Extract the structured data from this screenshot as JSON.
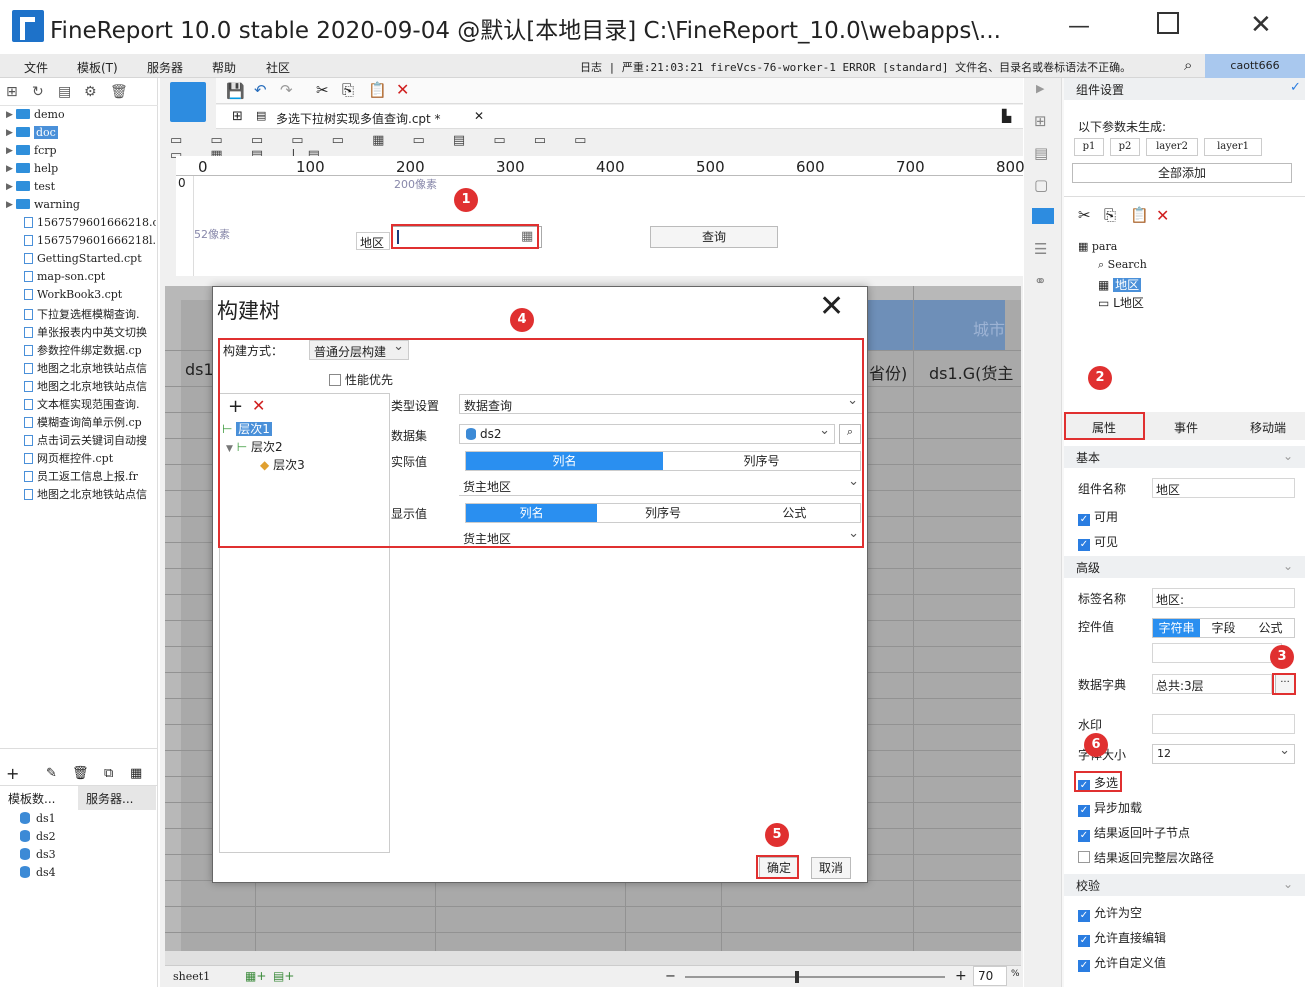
{
  "window": {
    "title": "FineReport 10.0 stable 2020-09-04 @默认[本地目录]    C:\\FineReport_10.0\\webapps\\..."
  },
  "menu": {
    "items": [
      "文件",
      "模板(T)",
      "服务器",
      "帮助",
      "社区"
    ],
    "log": "日志 | 严重:21:03:21 fireVcs-76-worker-1 ERROR [standard] 文件名、目录名或卷标语法不正确。",
    "user": "caott666"
  },
  "left": {
    "folders": [
      "demo",
      "doc",
      "fcrp",
      "help",
      "test",
      "warning"
    ],
    "files": [
      "1567579601666218.cp",
      "1567579601666218l.c",
      "GettingStarted.cpt",
      "map-son.cpt",
      "WorkBook3.cpt",
      "下拉复选框模糊查询.",
      "单张报表内中英文切换",
      "参数控件绑定数据.cp",
      "地图之北京地铁站点信",
      "地图之北京地铁站点信",
      "文本框实现范围查询.",
      "模糊查询简单示例.cp",
      "点击词云关键词自动搜",
      "网页框控件.cpt",
      "员工返工信息上报.fr",
      "地图之北京地铁站点信"
    ],
    "tabs": [
      "模板数...",
      "服务器..."
    ],
    "datasets": [
      "ds1",
      "ds2",
      "ds3",
      "ds4"
    ]
  },
  "editor": {
    "tab": "多选下拉树实现多值查询.cpt *",
    "ruler": [
      "0",
      "100",
      "200",
      "300",
      "400",
      "500",
      "600",
      "700",
      "800"
    ],
    "hint1": "200像素",
    "hint2": "52像素",
    "label": "地区",
    "query_button": "查询",
    "cell_ds1": "ds1",
    "cell_prov": "省份)",
    "cell_ds1g": "ds1.G(货主",
    "cell_city": "城市",
    "sheet": "sheet1",
    "zoom": "70",
    "zoom_unit": "%"
  },
  "dialog": {
    "title": "构建树",
    "method_label": "构建方式：",
    "method_value": "普通分层构建",
    "perf_label": "性能优先",
    "levels": [
      "层次1",
      "层次2",
      "层次3"
    ],
    "type_label": "类型设置",
    "type_value": "数据查询",
    "dataset_label": "数据集",
    "dataset_value": "ds2",
    "actual_label": "实际值",
    "actual_tabs": [
      "列名",
      "列序号"
    ],
    "actual_value": "货主地区",
    "display_label": "显示值",
    "display_tabs": [
      "列名",
      "列序号",
      "公式"
    ],
    "display_value": "货主地区",
    "ok": "确定",
    "cancel": "取消"
  },
  "panel": {
    "header": "组件设置",
    "params_title": "以下参数未生成:",
    "params": [
      "p1",
      "p2",
      "layer2",
      "layer1"
    ],
    "add_all": "全部添加",
    "tree_root": "para",
    "tree_items": [
      "Search",
      "地区",
      "L地区"
    ],
    "tabs": [
      "属性",
      "事件",
      "移动端"
    ],
    "basic": "基本",
    "name_label": "组件名称",
    "name_value": "地区",
    "enabled": "可用",
    "visible": "可见",
    "advanced": "高级",
    "tag_label": "标签名称",
    "tag_value": "地区:",
    "value_label": "控件值",
    "value_tabs": [
      "字符串",
      "字段",
      "公式"
    ],
    "dict_label": "数据字典",
    "dict_value": "总共:3层",
    "watermark_label": "水印",
    "fontsize_label": "字体大小",
    "fontsize_value": "12",
    "multi": "多选",
    "async": "异步加载",
    "leaf": "结果返回叶子节点",
    "fullpath": "结果返回完整层次路径",
    "validate": "校验",
    "allow_empty": "允许为空",
    "allow_edit": "允许直接编辑",
    "allow_custom": "允许自定义值"
  },
  "markers": [
    "1",
    "2",
    "3",
    "4",
    "5",
    "6"
  ]
}
